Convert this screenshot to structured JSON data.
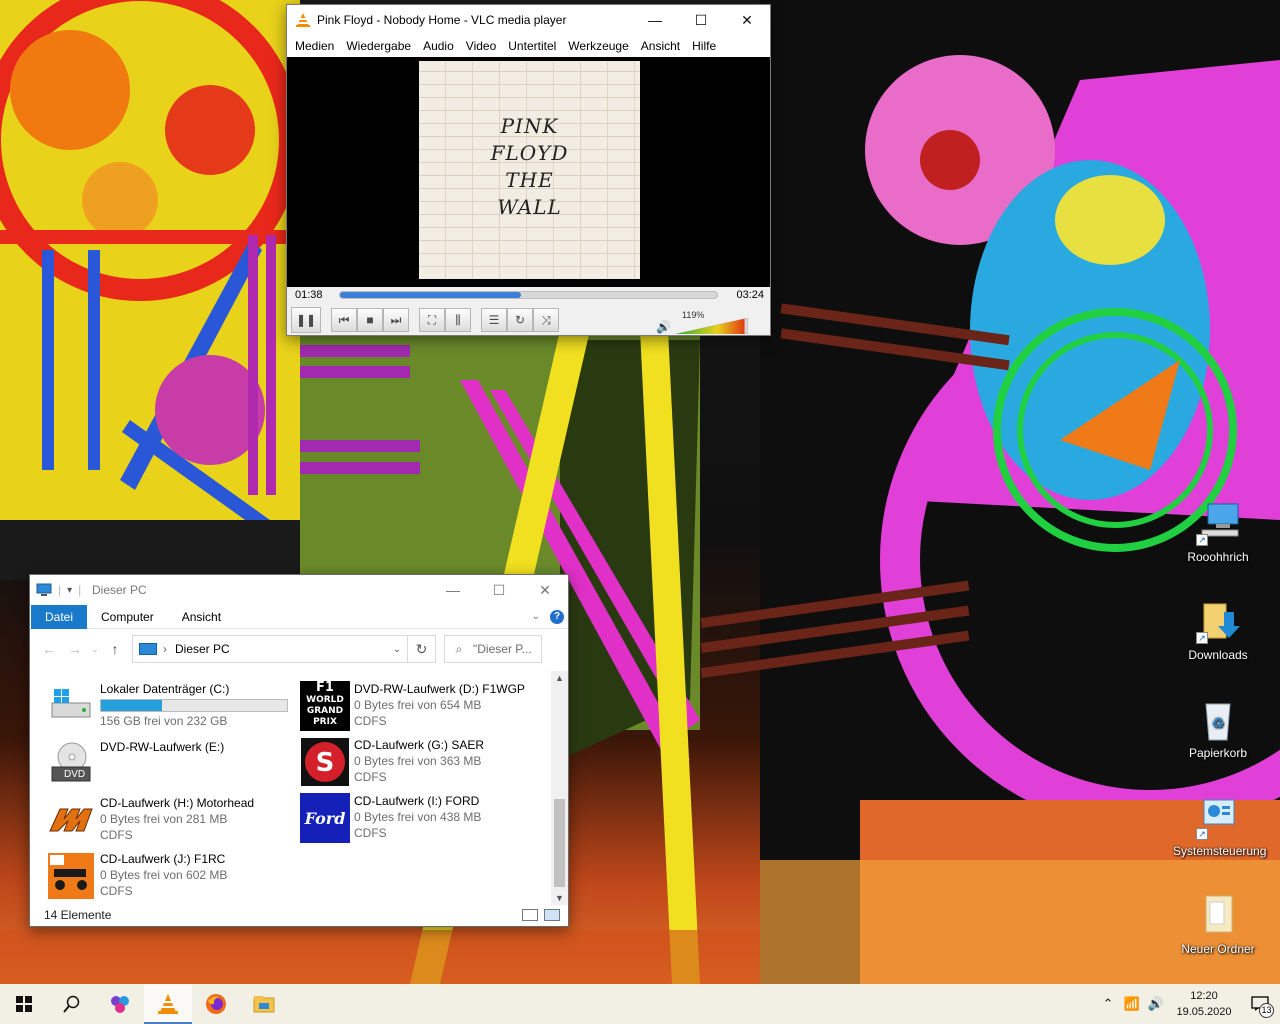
{
  "desktop": {
    "icons": [
      {
        "label": "Rooohhrich",
        "icon": "network-computer-icon"
      },
      {
        "label": "Downloads",
        "icon": "downloads-folder-icon"
      },
      {
        "label": "Papierkorb",
        "icon": "recycle-bin-icon"
      },
      {
        "label": "Systemsteuerung",
        "icon": "control-panel-icon"
      },
      {
        "label": "Neuer Ordner",
        "icon": "folder-icon"
      }
    ]
  },
  "vlc": {
    "title": "Pink Floyd - Nobody Home - VLC media player",
    "menu": [
      "Medien",
      "Wiedergabe",
      "Audio",
      "Video",
      "Untertitel",
      "Werkzeuge",
      "Ansicht",
      "Hilfe"
    ],
    "cover_text": [
      "PINK",
      "FLOYD",
      "THE",
      "WALL"
    ],
    "time_elapsed": "01:38",
    "time_total": "03:24",
    "progress": 0.48,
    "volume_label": "119%",
    "volume": 1.19
  },
  "explorer": {
    "title": "Dieser PC",
    "tabs": [
      "Datei",
      "Computer",
      "Ansicht"
    ],
    "address": "Dieser PC",
    "search_placeholder": "\"Dieser P...",
    "drives": [
      {
        "name": "Lokaler Datenträger (C:)",
        "free": "156 GB frei von 232 GB",
        "fs": "",
        "used_fraction": 0.33,
        "icon": "windows-drive-icon"
      },
      {
        "name": "DVD-RW-Laufwerk (D:) F1WGP",
        "free": "0 Bytes frei von 654 MB",
        "fs": "CDFS",
        "icon": "f1-world-grand-prix-icon"
      },
      {
        "name": "DVD-RW-Laufwerk (E:)",
        "free": "",
        "fs": "",
        "icon": "dvd-drive-icon"
      },
      {
        "name": "CD-Laufwerk (G:) SAER",
        "free": "0 Bytes frei von 363 MB",
        "fs": "CDFS",
        "icon": "suzuki-logo-icon"
      },
      {
        "name": "CD-Laufwerk (H:) Motorhead",
        "free": "0 Bytes frei von 281 MB",
        "fs": "CDFS",
        "icon": "motorhead-logo-icon"
      },
      {
        "name": "CD-Laufwerk (I:) FORD",
        "free": "0 Bytes frei von 438 MB",
        "fs": "CDFS",
        "icon": "ford-logo-icon"
      },
      {
        "name": "CD-Laufwerk (J:) F1RC",
        "free": "0 Bytes frei von 602 MB",
        "fs": "CDFS",
        "icon": "f1rc-icon"
      }
    ],
    "dvd_badge": "DVD",
    "f1_badge": [
      "F1",
      "WORLD",
      "GRAND",
      "PRIX"
    ],
    "ford_badge": "Ford",
    "status": "14 Elemente"
  },
  "taskbar": {
    "time": "12:20",
    "date": "19.05.2020",
    "notifications": "13"
  },
  "colors": {
    "accent": "#1979ca",
    "vlc_orange": "#f28c00",
    "progress_blue": "#3b7fd6",
    "drive_bar": "#26a0da"
  }
}
